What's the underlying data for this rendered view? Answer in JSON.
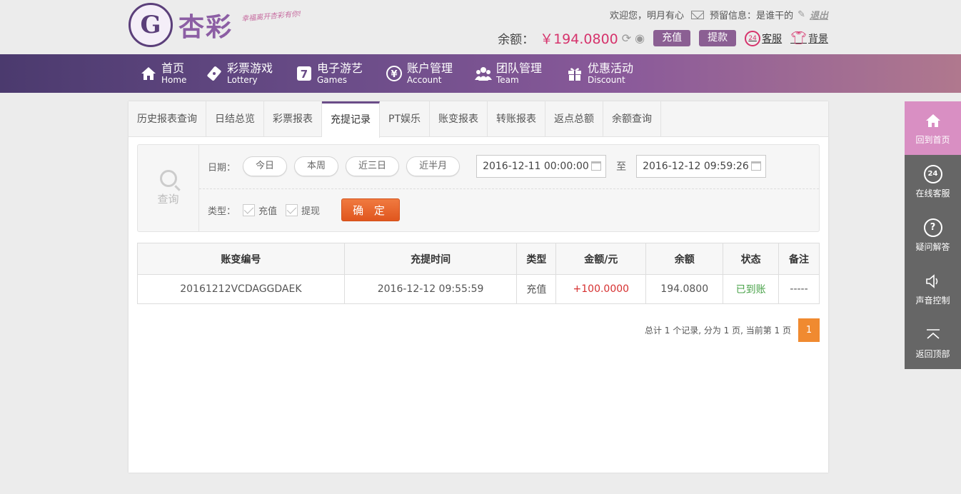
{
  "brand": {
    "mark": "G",
    "name": "杏彩",
    "slogan": "幸福离开杏彩有你!"
  },
  "top": {
    "welcome": "欢迎您，",
    "username": "明月有心",
    "reserved_label": "预留信息：",
    "reserved_value": "是谁干的",
    "logout": "退出"
  },
  "balance": {
    "label": "余额：",
    "value": "￥194.0800",
    "deposit_btn": "充值",
    "withdraw_btn": "提款",
    "service": "客服",
    "service_badge": "24",
    "theme": "背景"
  },
  "nav": [
    {
      "zh": "首页",
      "en": "Home",
      "icon": "home-icon"
    },
    {
      "zh": "彩票游戏",
      "en": "Lottery",
      "icon": "ticket-icon"
    },
    {
      "zh": "电子游艺",
      "en": "Games",
      "icon": "seven-icon"
    },
    {
      "zh": "账户管理",
      "en": "Account",
      "icon": "yen-icon"
    },
    {
      "zh": "团队管理",
      "en": "Team",
      "icon": "team-icon"
    },
    {
      "zh": "优惠活动",
      "en": "Discount",
      "icon": "gift-icon"
    }
  ],
  "tabs": [
    "历史报表查询",
    "日结总览",
    "彩票报表",
    "充提记录",
    "PT娱乐",
    "账变报表",
    "转账报表",
    "返点总额",
    "余额查询"
  ],
  "active_tab": "充提记录",
  "query": {
    "title": "查询",
    "date_label": "日期：",
    "quick": [
      "今日",
      "本周",
      "近三日",
      "近半月"
    ],
    "start": "2016-12-11 00:00:00",
    "to": "至",
    "end": "2016-12-12 09:59:26",
    "type_label": "类型：",
    "types": [
      "充值",
      "提现"
    ],
    "confirm": "确 定"
  },
  "table": {
    "headers": [
      "账变编号",
      "充提时间",
      "类型",
      "金额/元",
      "余额",
      "状态",
      "备注"
    ],
    "rows": [
      [
        "20161212VCDAGGDAEK",
        "2016-12-12 09:55:59",
        "充值",
        "+100.0000",
        "194.0800",
        "已到账",
        "-----"
      ]
    ]
  },
  "pager": {
    "summary": "总计 1 个记录, 分为 1 页, 当前第 1 页",
    "current": "1"
  },
  "sidebar": [
    {
      "label": "回到首页",
      "icon": "home-icon"
    },
    {
      "label": "在线客服",
      "icon": "headset-icon",
      "badge": "24"
    },
    {
      "label": "疑问解答",
      "icon": "question-icon",
      "badge": "?"
    },
    {
      "label": "声音控制",
      "icon": "speaker-icon"
    },
    {
      "label": "返回顶部",
      "icon": "top-arrow-icon"
    }
  ],
  "colors": {
    "nav_start": "#4b3a6e",
    "nav_end": "#b0788e",
    "accent_pink": "#d6336c",
    "confirm_orange": "#e8632a",
    "side_active": "#d98fc3"
  }
}
